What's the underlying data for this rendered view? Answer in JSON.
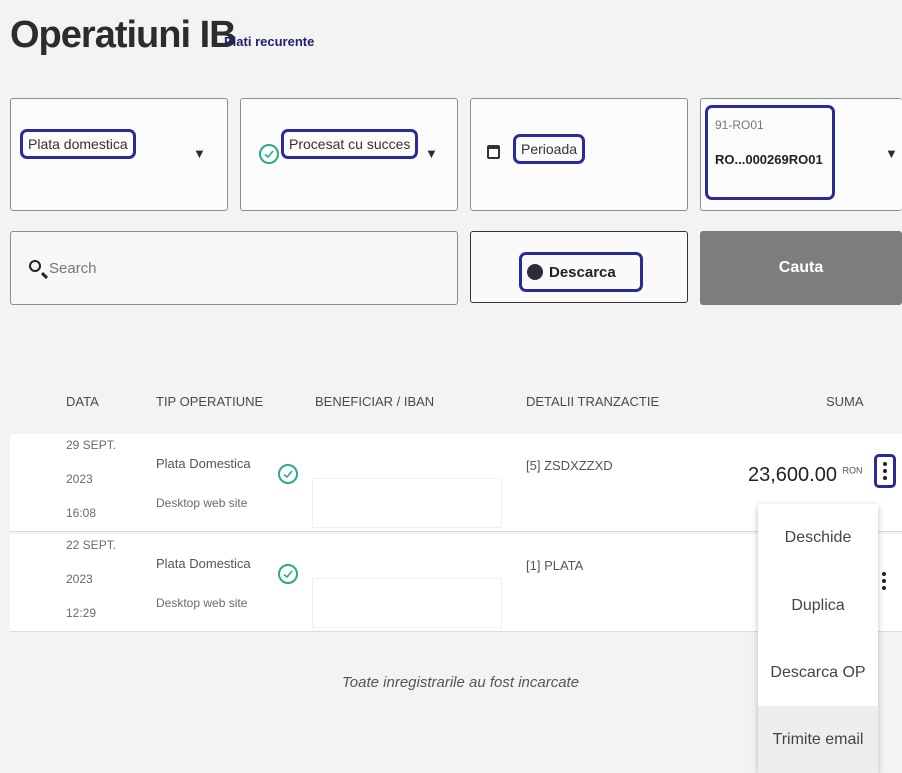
{
  "header": {
    "title": "Operatiuni IB",
    "subtitle": "Plati recurente"
  },
  "filters": {
    "operation_type": "Plata domestica",
    "status": "Procesat cu succes",
    "period": "Perioada",
    "account_code": "91-RO01",
    "account_iban": "RO...000269RO01"
  },
  "search": {
    "placeholder": "Search"
  },
  "actions": {
    "download_label": "Descarca",
    "search_label": "Cauta"
  },
  "table": {
    "headers": [
      "DATA",
      "TIP OPERATIUNE",
      "BENEFICIAR / IBAN",
      "DETALII TRANZACTIE",
      "SUMA"
    ],
    "rows": [
      {
        "date": "29 SEPT.",
        "year": "2023",
        "time": "16:08",
        "type": "Plata Domestica",
        "channel": "Desktop web site",
        "details": "[5] ZSDXZZXD",
        "amount": "23,600.00",
        "currency": "RON"
      },
      {
        "date": "22 SEPT.",
        "year": "2023",
        "time": "12:29",
        "type": "Plata Domestica",
        "channel": "Desktop web site",
        "details": "[1] PLATA",
        "amount": "",
        "currency": ""
      }
    ]
  },
  "context_menu": {
    "items": [
      "Deschide",
      "Duplica",
      "Descarca OP",
      "Trimite email"
    ]
  },
  "footer": {
    "note": "Toate inregistrarile au fost incarcate"
  },
  "colors": {
    "highlight": "#2a2a9a",
    "success": "#2ca98a",
    "cauta_button": "#7d7d7d"
  }
}
